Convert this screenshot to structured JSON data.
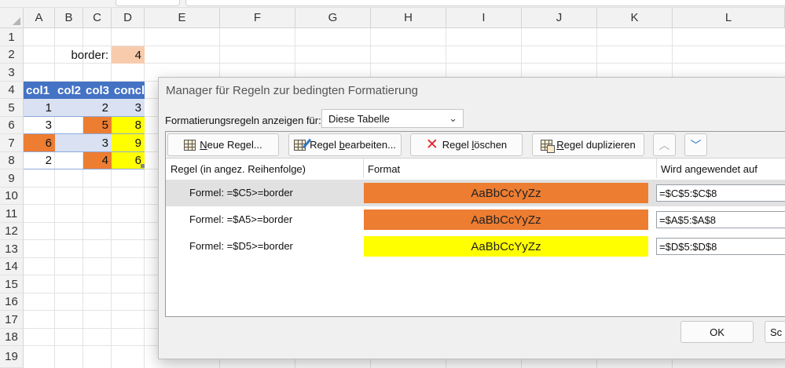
{
  "sheet": {
    "columns": [
      "A",
      "B",
      "C",
      "D",
      "E",
      "F",
      "G",
      "H",
      "I",
      "J",
      "K",
      "L"
    ],
    "rows": [
      "1",
      "2",
      "3",
      "4",
      "5",
      "6",
      "7",
      "8",
      "9",
      "10",
      "11",
      "12",
      "13",
      "14",
      "15",
      "16",
      "17",
      "18",
      "19"
    ],
    "border_label": "border:",
    "border_value": "4",
    "table_headers": [
      "col1",
      "col2",
      "col3",
      "concl"
    ],
    "table_rows": [
      [
        "1",
        "",
        "2",
        "3"
      ],
      [
        "3",
        "",
        "5",
        "8"
      ],
      [
        "6",
        "",
        "3",
        "9"
      ],
      [
        "2",
        "",
        "4",
        "6"
      ]
    ]
  },
  "dialog": {
    "title": "Manager für Regeln zur bedingten Formatierung",
    "show_rules_label": "Formatierungsregeln anzeigen für:",
    "show_rules_value": "Diese Tabelle",
    "buttons": {
      "new_rule_prefix": "N",
      "new_rule_rest": "eue Regel...",
      "edit_rule_prefix": "Regel ",
      "edit_rule_ul": "b",
      "edit_rule_rest": "earbeiten...",
      "delete_rule_prefix": "Regel ",
      "delete_rule_ul": "l",
      "delete_rule_rest": "öschen",
      "duplicate_rule_ul": "R",
      "duplicate_rule_rest": "egel duplizieren",
      "move_up": "︿",
      "move_down": "﹀"
    },
    "columns": {
      "rule": "Regel (in angez. Reihenfolge)",
      "format": "Format",
      "applies": "Wird angewendet auf"
    },
    "rules": [
      {
        "formula": "Formel: =$C5>=border",
        "preview": "AaBbCcYyZz",
        "color": "#ed7d31",
        "applies_to": "=$C$5:$C$8"
      },
      {
        "formula": "Formel: =$A5>=border",
        "preview": "AaBbCcYyZz",
        "color": "#ed7d31",
        "applies_to": "=$A$5:$A$8"
      },
      {
        "formula": "Formel: =$D5>=border",
        "preview": "AaBbCcYyZz",
        "color": "#ffff00",
        "applies_to": "=$D$5:$D$8"
      }
    ],
    "ok_label": "OK",
    "second_button_label": "Sc"
  }
}
